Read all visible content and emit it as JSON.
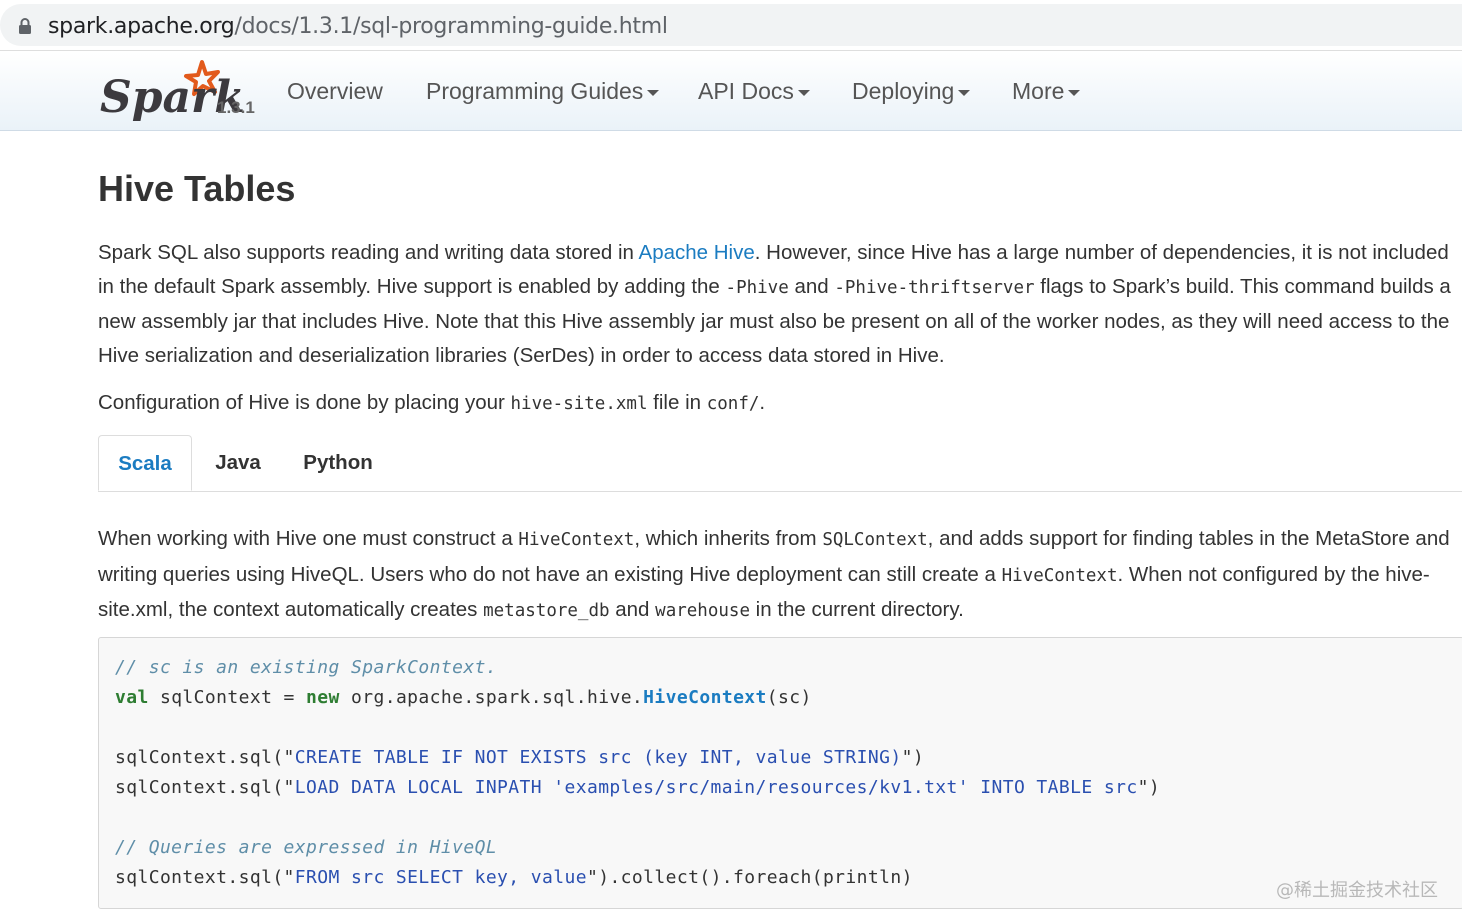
{
  "browser": {
    "url_host": "spark.apache.org",
    "url_path": "/docs/1.3.1/sql-programming-guide.html"
  },
  "navbar": {
    "brand_version": "1.3.1",
    "items": [
      {
        "label": "Overview",
        "dropdown": false
      },
      {
        "label": "Programming Guides",
        "dropdown": true
      },
      {
        "label": "API Docs",
        "dropdown": true
      },
      {
        "label": "Deploying",
        "dropdown": true
      },
      {
        "label": "More",
        "dropdown": true
      }
    ]
  },
  "content": {
    "title": "Hive Tables",
    "p1": {
      "t1": "Spark SQL also supports reading and writing data stored in ",
      "link": "Apache Hive",
      "t2": ". However, since Hive has a large number of dependencies, it is not included in the default Spark assembly. Hive support is enabled by adding the ",
      "c1": "-Phive",
      "t3": " and ",
      "c2": "-Phive-thriftserver",
      "t4": " flags to Spark’s build. This command builds a new assembly jar that includes Hive. Note that this Hive assembly jar must also be present on all of the worker nodes, as they will need access to the Hive serialization and deserialization libraries (SerDes) in order to access data stored in Hive."
    },
    "p2": {
      "t1": "Configuration of Hive is done by placing your ",
      "c1": "hive-site.xml",
      "t2": " file in ",
      "c2": "conf/",
      "t3": "."
    },
    "tabs": [
      "Scala",
      "Java",
      "Python"
    ],
    "active_tab": "Scala",
    "p3": {
      "t1": "When working with Hive one must construct a ",
      "c1": "HiveContext",
      "t2": ", which inherits from ",
      "c2": "SQLContext",
      "t3": ", and adds support for finding tables in the MetaStore and writing queries using HiveQL. Users who do not have an existing Hive deployment can still create a ",
      "c3": "HiveContext",
      "t4": ". When not configured by the hive-site.xml, the context automatically creates ",
      "c4": "metastore_db",
      "t5": " and ",
      "c5": "warehouse",
      "t6": " in the current directory."
    },
    "code": {
      "l1_comment": "// sc is an existing SparkContext.",
      "l2_kw1": "val",
      "l2_a": " sqlContext = ",
      "l2_kw2": "new",
      "l2_b": " org.apache.spark.sql.hive.",
      "l2_cls": "HiveContext",
      "l2_c": "(sc)",
      "l3_a": "sqlContext.sql(\"",
      "l3_str": "CREATE TABLE IF NOT EXISTS src (key INT, value STRING)",
      "l3_b": "\")",
      "l4_a": "sqlContext.sql(\"",
      "l4_str": "LOAD DATA LOCAL INPATH 'examples/src/main/resources/kv1.txt' INTO TABLE src",
      "l4_b": "\")",
      "l5_comment": "// Queries are expressed in HiveQL",
      "l6_a": "sqlContext.sql(\"",
      "l6_str": "FROM src SELECT key, value",
      "l6_b": "\").collect().foreach(println)"
    }
  },
  "watermark": "@稀土掘金技术社区"
}
